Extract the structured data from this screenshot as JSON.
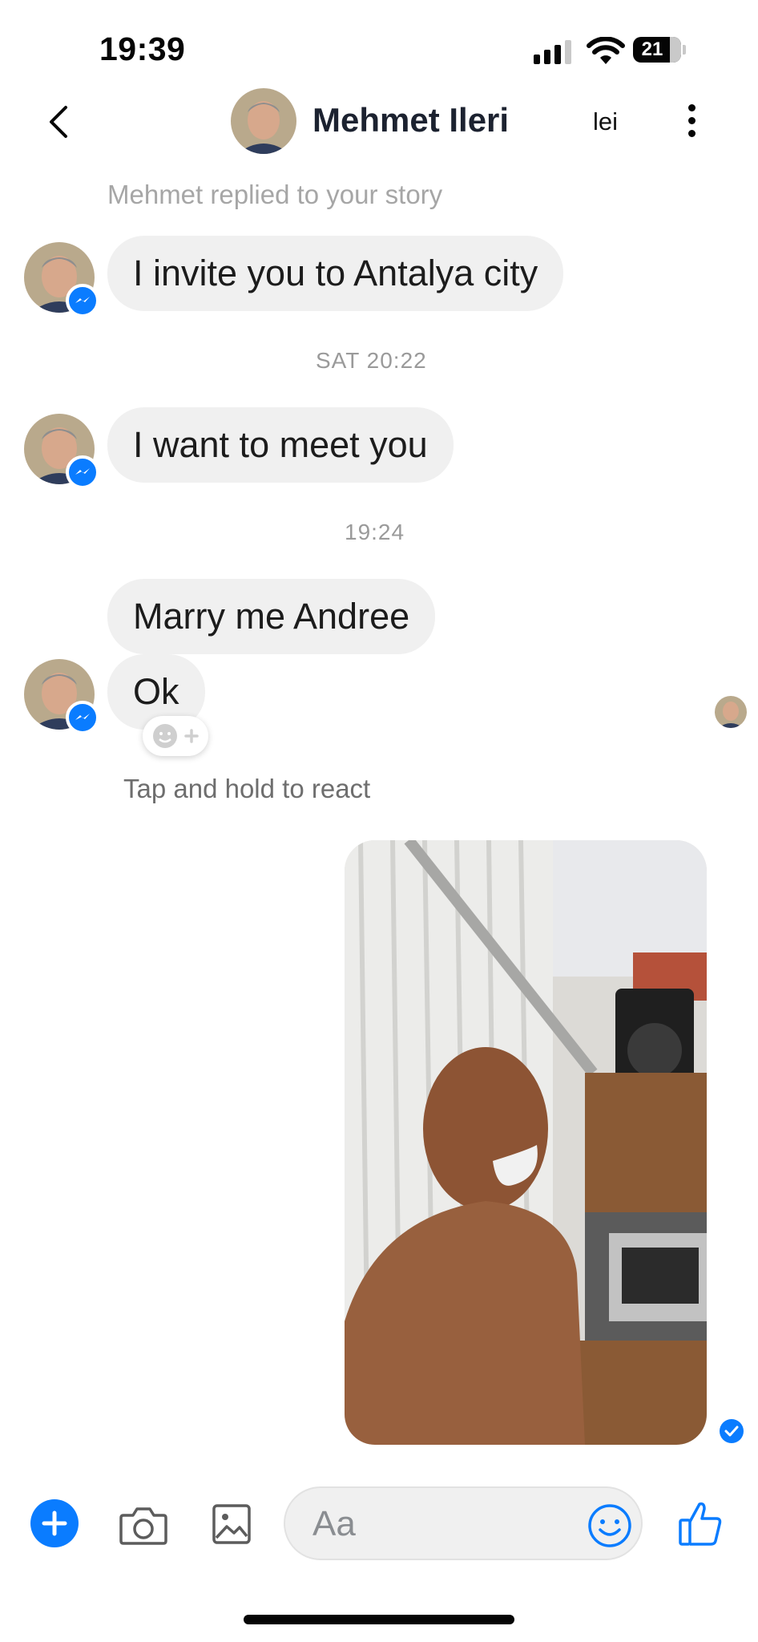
{
  "status_bar": {
    "time": "19:39",
    "battery": "21"
  },
  "header": {
    "contact_name": "Mehmet Ileri",
    "right_label": "lei"
  },
  "thread": {
    "story_reply_note": "Mehmet replied to your story",
    "separator_1": "SAT 20:22",
    "separator_2": "19:24",
    "messages": [
      {
        "from": "Mehmet",
        "text": "I invite you to Antalya city"
      },
      {
        "from": "Mehmet",
        "text": "I want to meet you"
      },
      {
        "from": "Mehmet",
        "text": "Marry me Andree"
      },
      {
        "from": "Mehmet",
        "text": "Ok"
      }
    ],
    "react_hint": "Tap and hold to react"
  },
  "composer": {
    "placeholder": "Aa"
  },
  "icons": {
    "back": "chevron-left-icon",
    "more": "vertical-dots-icon",
    "plus": "plus-icon",
    "camera": "camera-icon",
    "gallery": "image-icon",
    "emoji": "smiley-icon",
    "like": "thumbs-up-icon",
    "messenger_badge": "messenger-icon"
  },
  "colors": {
    "accent": "#0a7cff",
    "bubble_bg": "#f0f0f0",
    "muted_text": "#a6a6a6"
  }
}
